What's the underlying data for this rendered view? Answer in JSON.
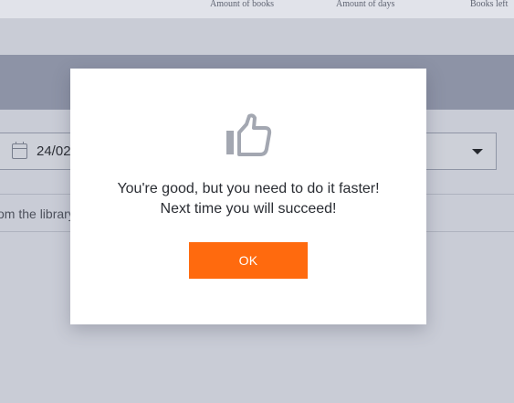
{
  "table_header": {
    "columns": [
      "Amount of books",
      "Amount of days",
      "Books left"
    ]
  },
  "date_picker": {
    "value": "24/02/"
  },
  "list_row": {
    "text": "om the library"
  },
  "modal": {
    "icon": "thumbs-up-icon",
    "message_line1": "You're good, but you need to do it faster!",
    "message_line2": "Next time you will succeed!",
    "ok_label": "OK"
  },
  "colors": {
    "accent": "#ff6a0e",
    "icon": "#a3a7b1",
    "overlay": "#c9ccd6"
  }
}
